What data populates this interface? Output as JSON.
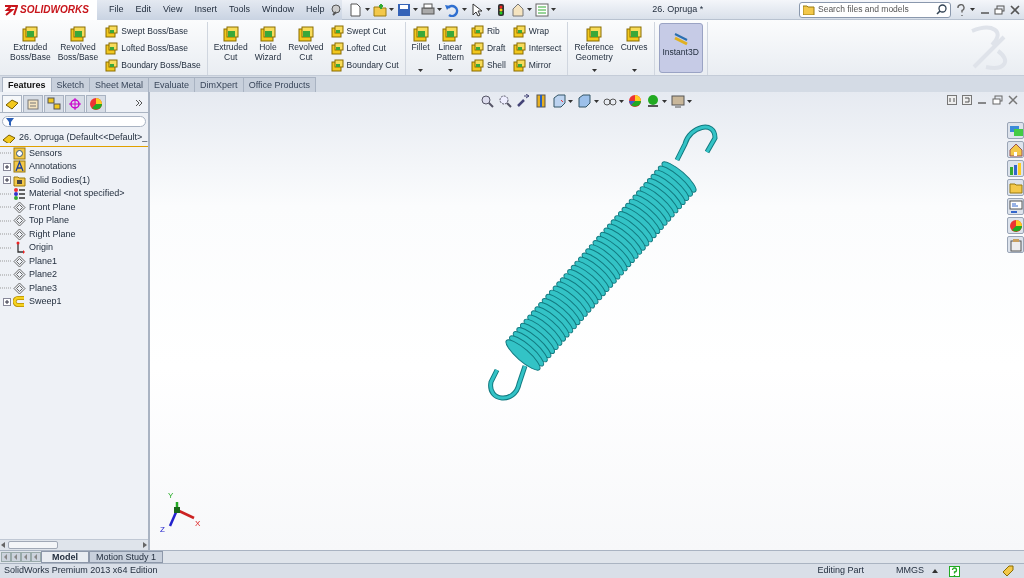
{
  "app": {
    "logo": "SOLIDWORKS"
  },
  "menu": [
    {
      "label": "File"
    },
    {
      "label": "Edit"
    },
    {
      "label": "View"
    },
    {
      "label": "Insert"
    },
    {
      "label": "Tools"
    },
    {
      "label": "Window"
    },
    {
      "label": "Help"
    }
  ],
  "document_title": "26. Opruga *",
  "search": {
    "placeholder": "Search files and models"
  },
  "ribbon": [
    {
      "items": [
        {
          "kind": "large",
          "label": "Extruded\nBoss/Base",
          "dropdown": false
        },
        {
          "kind": "large",
          "label": "Revolved\nBoss/Base",
          "dropdown": false
        },
        {
          "kind": "stack",
          "items": [
            {
              "label": "Swept Boss/Base"
            },
            {
              "label": "Lofted Boss/Base"
            },
            {
              "label": "Boundary Boss/Base"
            }
          ]
        }
      ]
    },
    {
      "items": [
        {
          "kind": "large",
          "label": "Extruded\nCut",
          "dropdown": false
        },
        {
          "kind": "large",
          "label": "Hole\nWizard",
          "dropdown": false
        },
        {
          "kind": "large",
          "label": "Revolved\nCut",
          "dropdown": false
        },
        {
          "kind": "stack",
          "items": [
            {
              "label": "Swept Cut"
            },
            {
              "label": "Lofted Cut"
            },
            {
              "label": "Boundary Cut"
            }
          ]
        }
      ]
    },
    {
      "items": [
        {
          "kind": "large",
          "label": "Fillet",
          "dropdown": true
        },
        {
          "kind": "large",
          "label": "Linear\nPattern",
          "dropdown": true
        },
        {
          "kind": "stack",
          "items": [
            {
              "label": "Rib"
            },
            {
              "label": "Draft"
            },
            {
              "label": "Shell"
            }
          ]
        },
        {
          "kind": "stack",
          "items": [
            {
              "label": "Wrap"
            },
            {
              "label": "Intersect"
            },
            {
              "label": "Mirror"
            }
          ]
        }
      ]
    },
    {
      "items": [
        {
          "kind": "large",
          "label": "Reference\nGeometry",
          "dropdown": true
        },
        {
          "kind": "large",
          "label": "Curves",
          "dropdown": true
        }
      ]
    },
    {
      "items": [
        {
          "kind": "toggle",
          "label": "Instant3D",
          "selected": true
        }
      ]
    }
  ],
  "command_tabs": [
    {
      "label": "Features",
      "selected": true
    },
    {
      "label": "Sketch",
      "selected": false
    },
    {
      "label": "Sheet Metal",
      "selected": false
    },
    {
      "label": "Evaluate",
      "selected": false
    },
    {
      "label": "DimXpert",
      "selected": false
    },
    {
      "label": "Office Products",
      "selected": false
    }
  ],
  "panel_tabs": [
    {
      "selected": true
    },
    {
      "selected": false
    },
    {
      "selected": false
    },
    {
      "selected": false
    },
    {
      "selected": false
    }
  ],
  "tree": {
    "root": "26. Opruga  (Default<<Default>_",
    "children": [
      {
        "label": "Sensors",
        "kind": "sensors",
        "expandable": false
      },
      {
        "label": "Annotations",
        "kind": "annotations",
        "expandable": true
      },
      {
        "label": "Solid Bodies(1)",
        "kind": "bodies",
        "expandable": true
      },
      {
        "label": "Material <not specified>",
        "kind": "material",
        "expandable": false
      },
      {
        "label": "Front Plane",
        "kind": "plane",
        "expandable": false
      },
      {
        "label": "Top Plane",
        "kind": "plane",
        "expandable": false
      },
      {
        "label": "Right Plane",
        "kind": "plane",
        "expandable": false
      },
      {
        "label": "Origin",
        "kind": "origin",
        "expandable": false
      },
      {
        "label": "Plane1",
        "kind": "plane",
        "expandable": false
      },
      {
        "label": "Plane2",
        "kind": "plane",
        "expandable": false
      },
      {
        "label": "Plane3",
        "kind": "plane",
        "expandable": false
      },
      {
        "label": "Sweep1",
        "kind": "sweep",
        "expandable": true
      }
    ]
  },
  "triad": {
    "x": "X",
    "y": "Y",
    "z": "Z"
  },
  "bottom_tabs": [
    {
      "label": "Model",
      "selected": true
    },
    {
      "label": "Motion Study 1",
      "selected": false
    }
  ],
  "status_bar": {
    "edition": "SolidWorks Premium 2013 x64 Edition",
    "mode": "Editing Part",
    "units": "MMGS"
  }
}
